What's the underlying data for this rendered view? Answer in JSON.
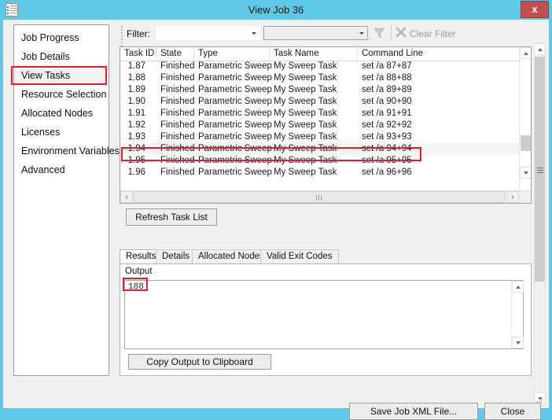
{
  "window": {
    "title": "View Job 36",
    "icon": "document-icon",
    "close_label": "x",
    "accent_color": "#5ec8e8",
    "highlight_color": "#ed1c24"
  },
  "sidebar": {
    "items": [
      {
        "label": "Job Progress",
        "selected": false,
        "highlighted": false
      },
      {
        "label": "Job Details",
        "selected": false,
        "highlighted": false
      },
      {
        "label": "View Tasks",
        "selected": true,
        "highlighted": true
      },
      {
        "label": "Resource Selection",
        "selected": false,
        "highlighted": false
      },
      {
        "label": "Allocated Nodes",
        "selected": false,
        "highlighted": false
      },
      {
        "label": "Licenses",
        "selected": false,
        "highlighted": false
      },
      {
        "label": "Environment Variables",
        "selected": false,
        "highlighted": false
      },
      {
        "label": "Advanced",
        "selected": false,
        "highlighted": false
      }
    ]
  },
  "toolbar": {
    "filter_label": "Filter:",
    "filter_field_value": "",
    "filter_value_value": "",
    "funnel_icon": "funnel-icon",
    "clear_filter_label": "Clear Filter",
    "clear_filter_icon": "close-x-icon"
  },
  "grid": {
    "columns": [
      "Task ID",
      "State",
      "Type",
      "Task Name",
      "Command Line"
    ],
    "rows": [
      {
        "task_id": "1.87",
        "state": "Finished",
        "type": "Parametric Sweep",
        "task_name": "My Sweep Task",
        "command_line": "set /a 87+87",
        "selected": false,
        "highlighted": false
      },
      {
        "task_id": "1.88",
        "state": "Finished",
        "type": "Parametric Sweep",
        "task_name": "My Sweep Task",
        "command_line": "set /a 88+88",
        "selected": false,
        "highlighted": false
      },
      {
        "task_id": "1.89",
        "state": "Finished",
        "type": "Parametric Sweep",
        "task_name": "My Sweep Task",
        "command_line": "set /a 89+89",
        "selected": false,
        "highlighted": false
      },
      {
        "task_id": "1.90",
        "state": "Finished",
        "type": "Parametric Sweep",
        "task_name": "My Sweep Task",
        "command_line": "set /a 90+90",
        "selected": false,
        "highlighted": false
      },
      {
        "task_id": "1.91",
        "state": "Finished",
        "type": "Parametric Sweep",
        "task_name": "My Sweep Task",
        "command_line": "set /a 91+91",
        "selected": false,
        "highlighted": false
      },
      {
        "task_id": "1.92",
        "state": "Finished",
        "type": "Parametric Sweep",
        "task_name": "My Sweep Task",
        "command_line": "set /a 92+92",
        "selected": false,
        "highlighted": false
      },
      {
        "task_id": "1.93",
        "state": "Finished",
        "type": "Parametric Sweep",
        "task_name": "My Sweep Task",
        "command_line": "set /a 93+93",
        "selected": false,
        "highlighted": false
      },
      {
        "task_id": "1.94",
        "state": "Finished",
        "type": "Parametric Sweep",
        "task_name": "My Sweep Task",
        "command_line": "set /a 94+94",
        "selected": true,
        "highlighted": true
      },
      {
        "task_id": "1.95",
        "state": "Finished",
        "type": "Parametric Sweep",
        "task_name": "My Sweep Task",
        "command_line": "set /a 95+95",
        "selected": false,
        "highlighted": false
      },
      {
        "task_id": "1.96",
        "state": "Finished",
        "type": "Parametric Sweep",
        "task_name": "My Sweep Task",
        "command_line": "set /a 96+96",
        "selected": false,
        "highlighted": false
      }
    ]
  },
  "actions": {
    "refresh_task_list": "Refresh Task List",
    "copy_output": "Copy Output to Clipboard",
    "save_job_xml": "Save Job XML File...",
    "close": "Close"
  },
  "tabs": [
    {
      "label": "Results",
      "active": true
    },
    {
      "label": "Details",
      "active": false
    },
    {
      "label": "Allocated Nodes",
      "active": false
    },
    {
      "label": "Valid Exit Codes",
      "active": false
    }
  ],
  "results": {
    "output_label": "Output",
    "output_value": "188",
    "output_highlighted": true
  }
}
